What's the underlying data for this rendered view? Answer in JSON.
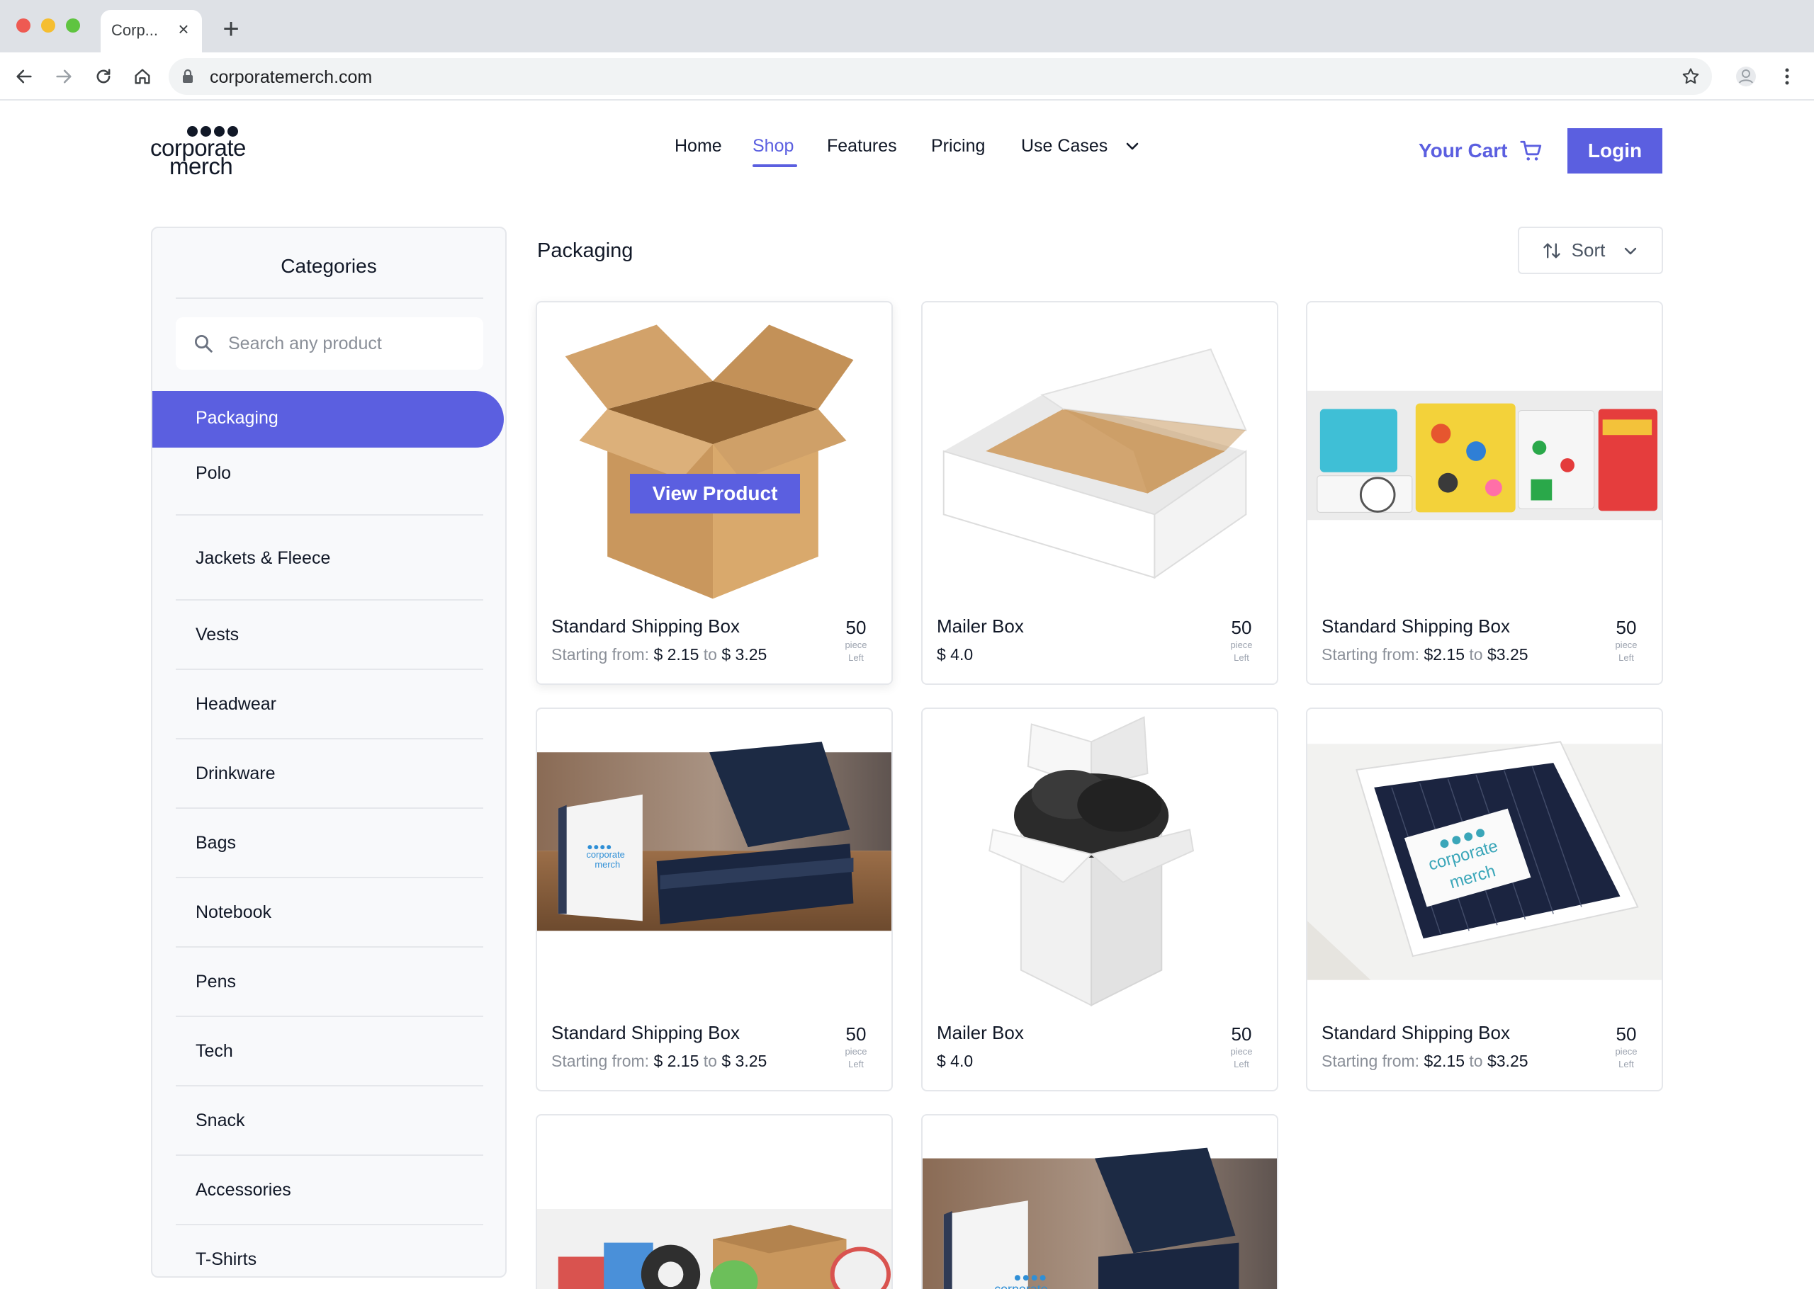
{
  "browser": {
    "tab_title": "Corp...",
    "url": "corporatemerch.com"
  },
  "site": {
    "logo_line1": "corporate",
    "logo_line2": "merch",
    "nav": [
      "Home",
      "Shop",
      "Features",
      "Pricing",
      "Use Cases"
    ],
    "active_nav": "Shop",
    "cart_label": "Your Cart",
    "login_label": "Login"
  },
  "sidebar": {
    "title": "Categories",
    "search_placeholder": "Search any product",
    "categories": [
      "Packaging",
      "Polo",
      "Jackets & Fleece",
      "Vests",
      "Headwear",
      "Drinkware",
      "Bags",
      "Notebook",
      "Pens",
      "Tech",
      "Snack",
      "Accessories",
      "T-Shirts"
    ],
    "active_category": "Packaging"
  },
  "main": {
    "title": "Packaging",
    "sort_label": "Sort",
    "view_product_label": "View Product",
    "stock_unit_line1": "piece",
    "stock_unit_line2": "Left",
    "products": [
      {
        "name": "Standard Shipping Box",
        "price_prefix": "Starting from:",
        "price_from": "$ 2.15",
        "price_to": "$ 3.25",
        "stock": "50"
      },
      {
        "name": "Mailer Box",
        "price_single": "$ 4.0",
        "stock": "50"
      },
      {
        "name": "Standard Shipping Box",
        "price_prefix": "Starting from:",
        "price_from": "$2.15",
        "price_to": "$3.25",
        "stock": "50"
      },
      {
        "name": "Standard Shipping Box",
        "price_prefix": "Starting from:",
        "price_from": "$ 2.15",
        "price_to": "$ 3.25",
        "stock": "50"
      },
      {
        "name": "Mailer Box",
        "price_single": "$ 4.0",
        "stock": "50"
      },
      {
        "name": "Standard Shipping Box",
        "price_prefix": "Starting from:",
        "price_from": "$2.15",
        "price_to": "$3.25",
        "stock": "50"
      }
    ],
    "price_to_word": "to",
    "box_print_line1": "corporate",
    "box_print_line2": "merch"
  },
  "colors": {
    "accent": "#5b5fe0",
    "text": "#111827",
    "muted": "#8a8f98",
    "border": "#e5e7eb",
    "sidebar_bg": "#f8f9fb"
  }
}
